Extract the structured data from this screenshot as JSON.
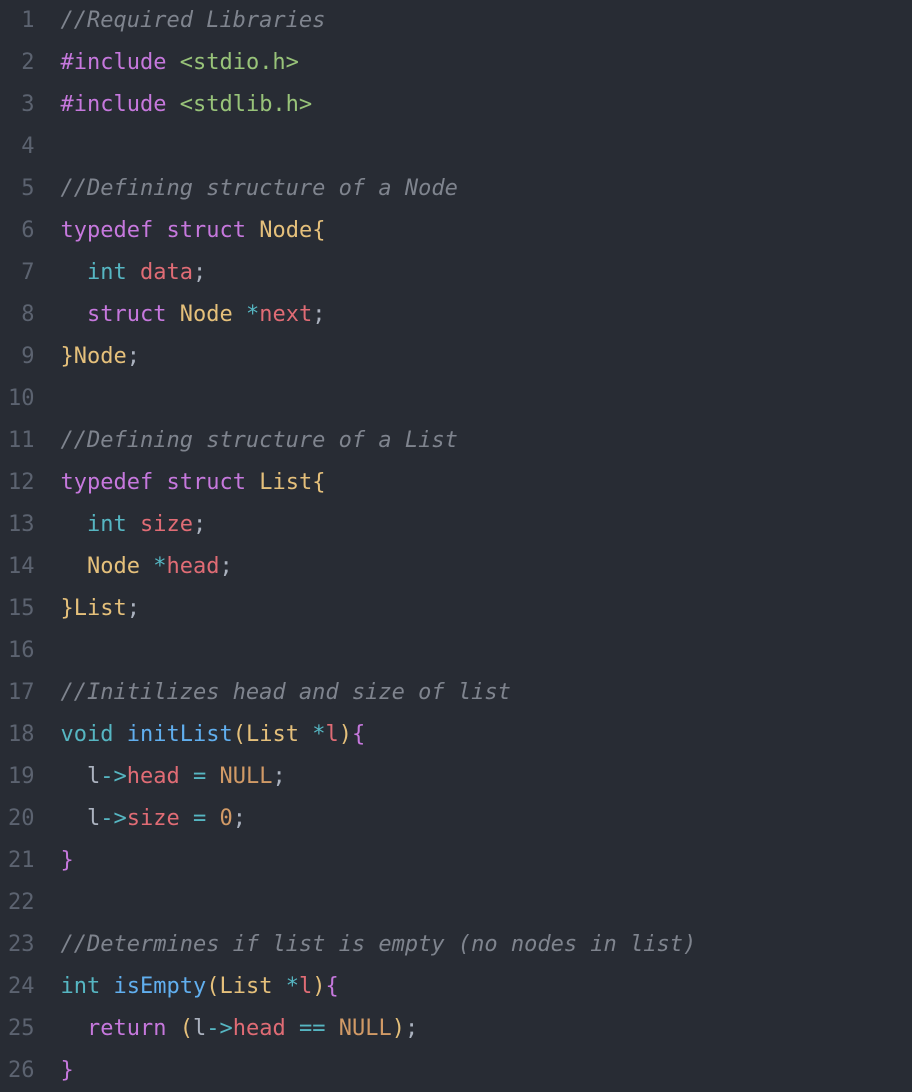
{
  "lineCount": 26,
  "lines": [
    {
      "n": 1,
      "tokens": [
        {
          "cls": "tok-comment",
          "t": "//Required Libraries"
        }
      ]
    },
    {
      "n": 2,
      "tokens": [
        {
          "cls": "tok-preproc",
          "t": "#include"
        },
        {
          "cls": "",
          "t": " "
        },
        {
          "cls": "tok-include-path",
          "t": "<stdio.h>"
        }
      ]
    },
    {
      "n": 3,
      "tokens": [
        {
          "cls": "tok-preproc",
          "t": "#include"
        },
        {
          "cls": "",
          "t": " "
        },
        {
          "cls": "tok-include-path",
          "t": "<stdlib.h>"
        }
      ]
    },
    {
      "n": 4,
      "tokens": [
        {
          "cls": "",
          "t": ""
        }
      ]
    },
    {
      "n": 5,
      "tokens": [
        {
          "cls": "tok-comment",
          "t": "//Defining structure of a Node"
        }
      ]
    },
    {
      "n": 6,
      "tokens": [
        {
          "cls": "tok-keyword",
          "t": "typedef"
        },
        {
          "cls": "",
          "t": " "
        },
        {
          "cls": "tok-keyword",
          "t": "struct"
        },
        {
          "cls": "",
          "t": " "
        },
        {
          "cls": "tok-typename",
          "t": "Node"
        },
        {
          "cls": "tok-brace",
          "t": "{"
        }
      ]
    },
    {
      "n": 7,
      "tokens": [
        {
          "cls": "",
          "t": "  "
        },
        {
          "cls": "tok-builtin-type",
          "t": "int"
        },
        {
          "cls": "",
          "t": " "
        },
        {
          "cls": "tok-field",
          "t": "data"
        },
        {
          "cls": "tok-semicolon",
          "t": ";"
        }
      ]
    },
    {
      "n": 8,
      "tokens": [
        {
          "cls": "",
          "t": "  "
        },
        {
          "cls": "tok-keyword",
          "t": "struct"
        },
        {
          "cls": "",
          "t": " "
        },
        {
          "cls": "tok-typename",
          "t": "Node"
        },
        {
          "cls": "",
          "t": " "
        },
        {
          "cls": "tok-star",
          "t": "*"
        },
        {
          "cls": "tok-field",
          "t": "next"
        },
        {
          "cls": "tok-semicolon",
          "t": ";"
        }
      ]
    },
    {
      "n": 9,
      "tokens": [
        {
          "cls": "tok-brace",
          "t": "}"
        },
        {
          "cls": "tok-typename",
          "t": "Node"
        },
        {
          "cls": "tok-semicolon",
          "t": ";"
        }
      ]
    },
    {
      "n": 10,
      "tokens": [
        {
          "cls": "",
          "t": ""
        }
      ]
    },
    {
      "n": 11,
      "tokens": [
        {
          "cls": "tok-comment",
          "t": "//Defining structure of a List"
        }
      ]
    },
    {
      "n": 12,
      "tokens": [
        {
          "cls": "tok-keyword",
          "t": "typedef"
        },
        {
          "cls": "",
          "t": " "
        },
        {
          "cls": "tok-keyword",
          "t": "struct"
        },
        {
          "cls": "",
          "t": " "
        },
        {
          "cls": "tok-typename",
          "t": "List"
        },
        {
          "cls": "tok-brace",
          "t": "{"
        }
      ]
    },
    {
      "n": 13,
      "tokens": [
        {
          "cls": "",
          "t": "  "
        },
        {
          "cls": "tok-builtin-type",
          "t": "int"
        },
        {
          "cls": "",
          "t": " "
        },
        {
          "cls": "tok-field",
          "t": "size"
        },
        {
          "cls": "tok-semicolon",
          "t": ";"
        }
      ]
    },
    {
      "n": 14,
      "tokens": [
        {
          "cls": "",
          "t": "  "
        },
        {
          "cls": "tok-typename",
          "t": "Node"
        },
        {
          "cls": "",
          "t": " "
        },
        {
          "cls": "tok-star",
          "t": "*"
        },
        {
          "cls": "tok-field",
          "t": "head"
        },
        {
          "cls": "tok-semicolon",
          "t": ";"
        }
      ]
    },
    {
      "n": 15,
      "tokens": [
        {
          "cls": "tok-brace",
          "t": "}"
        },
        {
          "cls": "tok-typename",
          "t": "List"
        },
        {
          "cls": "tok-semicolon",
          "t": ";"
        }
      ]
    },
    {
      "n": 16,
      "tokens": [
        {
          "cls": "",
          "t": ""
        }
      ]
    },
    {
      "n": 17,
      "tokens": [
        {
          "cls": "tok-comment",
          "t": "//Initilizes head and size of list"
        }
      ]
    },
    {
      "n": 18,
      "tokens": [
        {
          "cls": "tok-builtin-type",
          "t": "void"
        },
        {
          "cls": "",
          "t": " "
        },
        {
          "cls": "tok-func",
          "t": "initList"
        },
        {
          "cls": "tok-brace",
          "t": "("
        },
        {
          "cls": "tok-typename",
          "t": "List"
        },
        {
          "cls": "",
          "t": " "
        },
        {
          "cls": "tok-star",
          "t": "*"
        },
        {
          "cls": "tok-param",
          "t": "l"
        },
        {
          "cls": "tok-brace",
          "t": ")"
        },
        {
          "cls": "tok-brace2",
          "t": "{"
        }
      ]
    },
    {
      "n": 19,
      "tokens": [
        {
          "cls": "",
          "t": "  "
        },
        {
          "cls": "tok-identifier",
          "t": "l"
        },
        {
          "cls": "tok-operator",
          "t": "->"
        },
        {
          "cls": "tok-field",
          "t": "head"
        },
        {
          "cls": "",
          "t": " "
        },
        {
          "cls": "tok-operator",
          "t": "="
        },
        {
          "cls": "",
          "t": " "
        },
        {
          "cls": "tok-constant",
          "t": "NULL"
        },
        {
          "cls": "tok-semicolon",
          "t": ";"
        }
      ]
    },
    {
      "n": 20,
      "tokens": [
        {
          "cls": "",
          "t": "  "
        },
        {
          "cls": "tok-identifier",
          "t": "l"
        },
        {
          "cls": "tok-operator",
          "t": "->"
        },
        {
          "cls": "tok-field",
          "t": "size"
        },
        {
          "cls": "",
          "t": " "
        },
        {
          "cls": "tok-operator",
          "t": "="
        },
        {
          "cls": "",
          "t": " "
        },
        {
          "cls": "tok-number",
          "t": "0"
        },
        {
          "cls": "tok-semicolon",
          "t": ";"
        }
      ]
    },
    {
      "n": 21,
      "tokens": [
        {
          "cls": "tok-brace2",
          "t": "}"
        }
      ]
    },
    {
      "n": 22,
      "tokens": [
        {
          "cls": "",
          "t": ""
        }
      ]
    },
    {
      "n": 23,
      "tokens": [
        {
          "cls": "tok-comment",
          "t": "//Determines if list is empty (no nodes in list)"
        }
      ]
    },
    {
      "n": 24,
      "tokens": [
        {
          "cls": "tok-builtin-type",
          "t": "int"
        },
        {
          "cls": "",
          "t": " "
        },
        {
          "cls": "tok-func",
          "t": "isEmpty"
        },
        {
          "cls": "tok-brace",
          "t": "("
        },
        {
          "cls": "tok-typename",
          "t": "List"
        },
        {
          "cls": "",
          "t": " "
        },
        {
          "cls": "tok-star",
          "t": "*"
        },
        {
          "cls": "tok-param",
          "t": "l"
        },
        {
          "cls": "tok-brace",
          "t": ")"
        },
        {
          "cls": "tok-brace2",
          "t": "{"
        }
      ]
    },
    {
      "n": 25,
      "tokens": [
        {
          "cls": "",
          "t": "  "
        },
        {
          "cls": "tok-return",
          "t": "return"
        },
        {
          "cls": "",
          "t": " "
        },
        {
          "cls": "tok-brace",
          "t": "("
        },
        {
          "cls": "tok-identifier",
          "t": "l"
        },
        {
          "cls": "tok-operator",
          "t": "->"
        },
        {
          "cls": "tok-field",
          "t": "head"
        },
        {
          "cls": "",
          "t": " "
        },
        {
          "cls": "tok-operator",
          "t": "=="
        },
        {
          "cls": "",
          "t": " "
        },
        {
          "cls": "tok-constant",
          "t": "NULL"
        },
        {
          "cls": "tok-brace",
          "t": ")"
        },
        {
          "cls": "tok-semicolon",
          "t": ";"
        }
      ]
    },
    {
      "n": 26,
      "tokens": [
        {
          "cls": "tok-brace2",
          "t": "}"
        }
      ]
    }
  ]
}
